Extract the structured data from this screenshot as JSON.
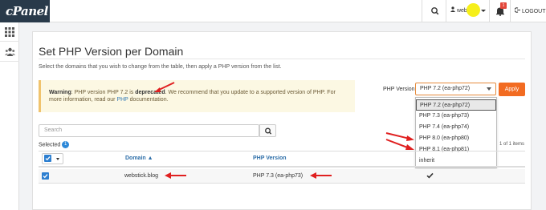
{
  "app": {
    "logo": "cPanel"
  },
  "topbar": {
    "username": "web",
    "notification_count": "1",
    "logout_label": "LOGOUT"
  },
  "page": {
    "title": "Set PHP Version per Domain",
    "intro": "Select the domains that you wish to change from the table, then apply a PHP version from the list."
  },
  "warning": {
    "label": "Warning",
    "text_before": ": PHP version PHP 7.2 is ",
    "emphasis": "deprecated",
    "text_after": ". We recommend that you update to a supported version of PHP. For",
    "line2_before": "more information, read our ",
    "link": "PHP",
    "line2_after": " documentation."
  },
  "version_picker": {
    "label": "PHP Version",
    "selected": "PHP 7.2 (ea-php72)",
    "apply_label": "Apply",
    "options": [
      "PHP 7.2 (ea-php72)",
      "PHP 7.3 (ea-php73)",
      "PHP 7.4 (ea-php74)",
      "PHP 8.0 (ea-php80)",
      "PHP 8.1 (ea-php81)",
      "inherit"
    ]
  },
  "table": {
    "search_placeholder": "Search",
    "selected_label": "Selected",
    "selected_count": "1",
    "pagination": "1 of 1 items",
    "columns": {
      "domain": "Domain ▲",
      "php_version": "PHP Version"
    },
    "rows": [
      {
        "domain": "webstick.blog",
        "php_version": "PHP 7.3 (ea-php73)"
      }
    ]
  },
  "colors": {
    "accent": "#f26b21",
    "link": "#2d6ea8",
    "checkbox": "#2d7fd0",
    "annotation": "#e02020"
  }
}
